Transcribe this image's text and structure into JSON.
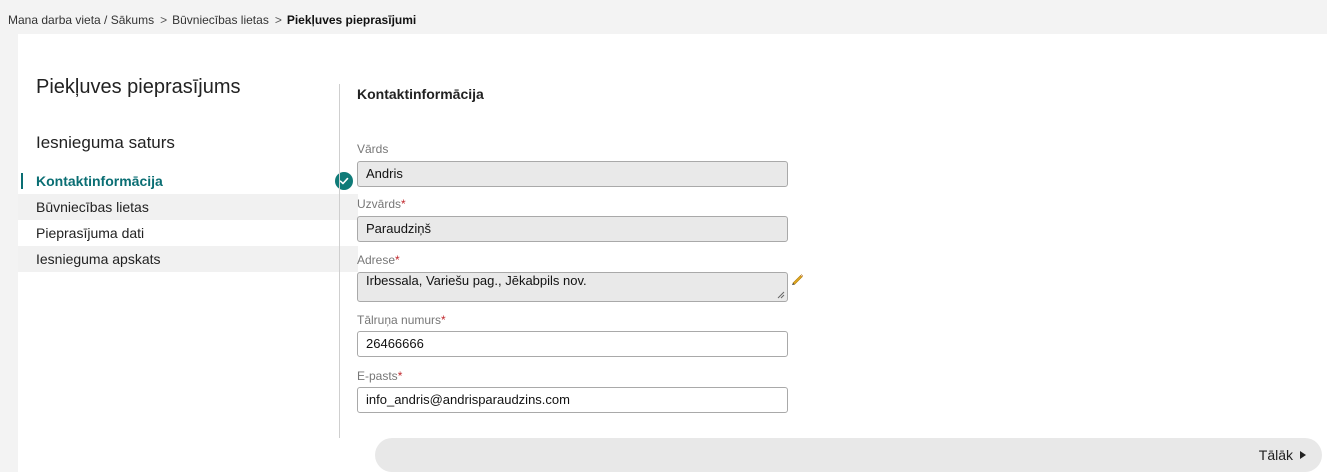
{
  "breadcrumb": {
    "items": [
      "Mana darba vieta / Sākums",
      "Būvniecības lietas"
    ],
    "current": "Piekļuves pieprasījumi",
    "separator": ">"
  },
  "page": {
    "title": "Piekļuves pieprasījums"
  },
  "sidebar": {
    "title": "Iesnieguma saturs",
    "items": [
      {
        "label": "Kontaktinformācija",
        "active": true,
        "completed": true
      },
      {
        "label": "Būvniecības lietas"
      },
      {
        "label": "Pieprasījuma dati"
      },
      {
        "label": "Iesnieguma apskats"
      }
    ],
    "check_icon": "check-circle-icon"
  },
  "form": {
    "section_title": "Kontaktinformācija",
    "fields": {
      "vards": {
        "label": "Vārds",
        "value": "Andris"
      },
      "uzvards": {
        "label": "Uzvārds",
        "required_mark": "*",
        "value": "Paraudziņš"
      },
      "adrese": {
        "label": "Adrese",
        "required_mark": "*",
        "value": "Irbessala, Variešu pag., Jēkabpils nov."
      },
      "talrunis": {
        "label": "Tālruņa numurs",
        "required_mark": "*",
        "value": "26466666"
      },
      "epasts": {
        "label": "E-pasts",
        "required_mark": "*",
        "value": "info_andris@andrisparaudzins.com"
      }
    },
    "edit_icon": "pencil-icon"
  },
  "footer": {
    "next_label": "Tālāk",
    "next_icon": "triangle-right-icon"
  },
  "colors": {
    "accent": "#0a6e73",
    "required": "#c0282d",
    "disabled_input": "#e9e9e9"
  }
}
